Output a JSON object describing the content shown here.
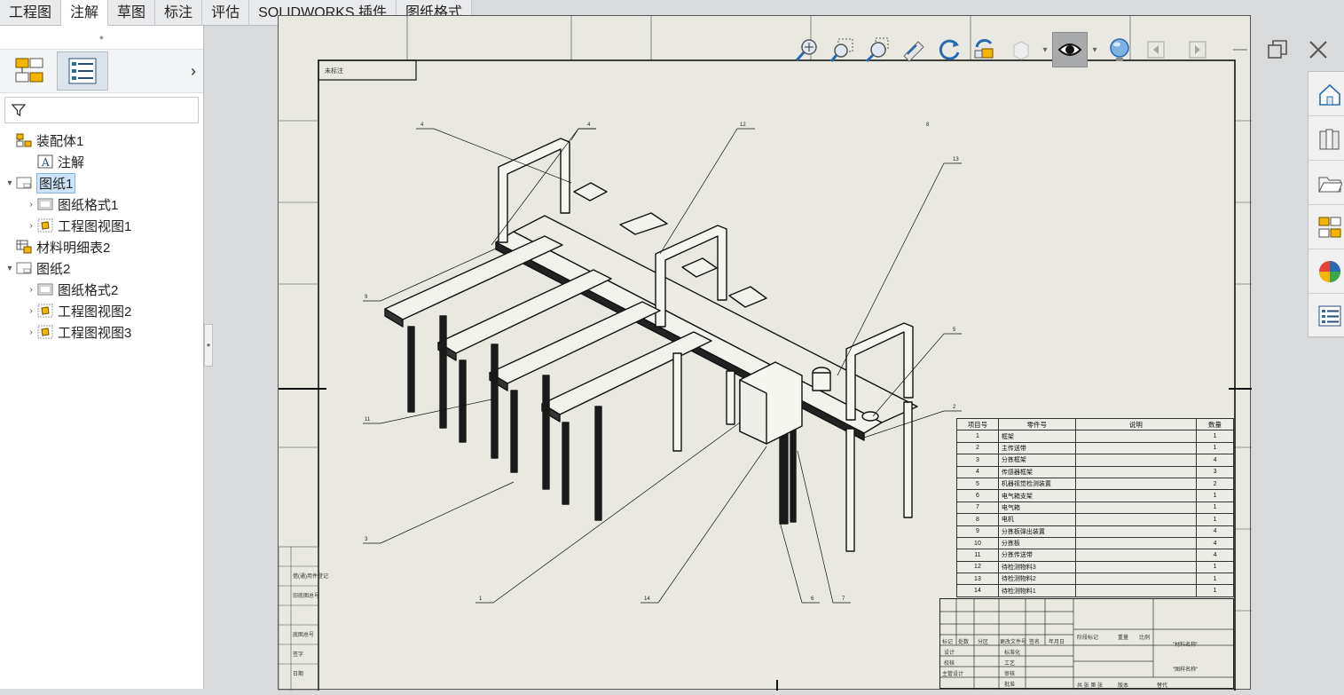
{
  "tabs": [
    {
      "label": "工程图",
      "active": false
    },
    {
      "label": "注解",
      "active": true
    },
    {
      "label": "草图",
      "active": false
    },
    {
      "label": "标注",
      "active": false
    },
    {
      "label": "评估",
      "active": false
    },
    {
      "label": "SOLIDWORKS 插件",
      "active": false
    },
    {
      "label": "图纸格式",
      "active": false
    }
  ],
  "panel_arrow": "›",
  "tree": [
    {
      "label": "装配体1",
      "level": 0,
      "expander": "",
      "icon": "assembly-icon"
    },
    {
      "label": "注解",
      "level": 1,
      "expander": "",
      "icon": "annotation-icon"
    },
    {
      "label": "图纸1",
      "level": 0,
      "expander": "▾",
      "icon": "sheet-icon",
      "selected": true
    },
    {
      "label": "图纸格式1",
      "level": 1,
      "expander": "›",
      "icon": "sheet-format-icon"
    },
    {
      "label": "工程图视图1",
      "level": 1,
      "expander": "›",
      "icon": "drawing-view-icon"
    },
    {
      "label": "材料明细表2",
      "level": 0,
      "expander": "",
      "icon": "bom-icon"
    },
    {
      "label": "图纸2",
      "level": 0,
      "expander": "▾",
      "icon": "sheet-icon"
    },
    {
      "label": "图纸格式2",
      "level": 1,
      "expander": "›",
      "icon": "sheet-format-icon"
    },
    {
      "label": "工程图视图2",
      "level": 1,
      "expander": "›",
      "icon": "drawing-view-icon"
    },
    {
      "label": "工程图视图3",
      "level": 1,
      "expander": "›",
      "icon": "drawing-view-icon"
    }
  ],
  "drawing": {
    "corner_note": "未标注",
    "balloons": [
      "4",
      "12",
      "8",
      "13",
      "9",
      "11",
      "3",
      "1",
      "14",
      "6",
      "7",
      "5",
      "2"
    ]
  },
  "bom": {
    "headers": [
      "项目号",
      "零件号",
      "说明",
      "数量"
    ],
    "rows": [
      [
        "1",
        "框架",
        "",
        "1"
      ],
      [
        "2",
        "主传送带",
        "",
        "1"
      ],
      [
        "3",
        "分拣框架",
        "",
        "4"
      ],
      [
        "4",
        "传感器框架",
        "",
        "3"
      ],
      [
        "5",
        "机器视觉检测装置",
        "",
        "2"
      ],
      [
        "6",
        "电气箱支架",
        "",
        "1"
      ],
      [
        "7",
        "电气箱",
        "",
        "1"
      ],
      [
        "8",
        "电机",
        "",
        "1"
      ],
      [
        "9",
        "分拣板弹出装置",
        "",
        "4"
      ],
      [
        "10",
        "分拣板",
        "",
        "4"
      ],
      [
        "11",
        "分拣传送带",
        "",
        "4"
      ],
      [
        "12",
        "待检测物料3",
        "",
        "1"
      ],
      [
        "13",
        "待检测物料2",
        "",
        "1"
      ],
      [
        "14",
        "待检测物料1",
        "",
        "1"
      ]
    ]
  },
  "title_block": {
    "material": "\"材料名称\"",
    "drawing_name": "\"图样名称\"",
    "labels": [
      "标记",
      "处数",
      "分区",
      "更改文件号",
      "签名",
      "年月日",
      "设计",
      "标准化",
      "校核",
      "工艺",
      "主管设计",
      "审核",
      "批准",
      "阶段标记",
      "重量",
      "比例",
      "共 张 第 张",
      "版本",
      "替代"
    ]
  },
  "side_strip": [
    "借(通)用件登记",
    "旧底图总号",
    "底图总号",
    "签字",
    "日期"
  ]
}
